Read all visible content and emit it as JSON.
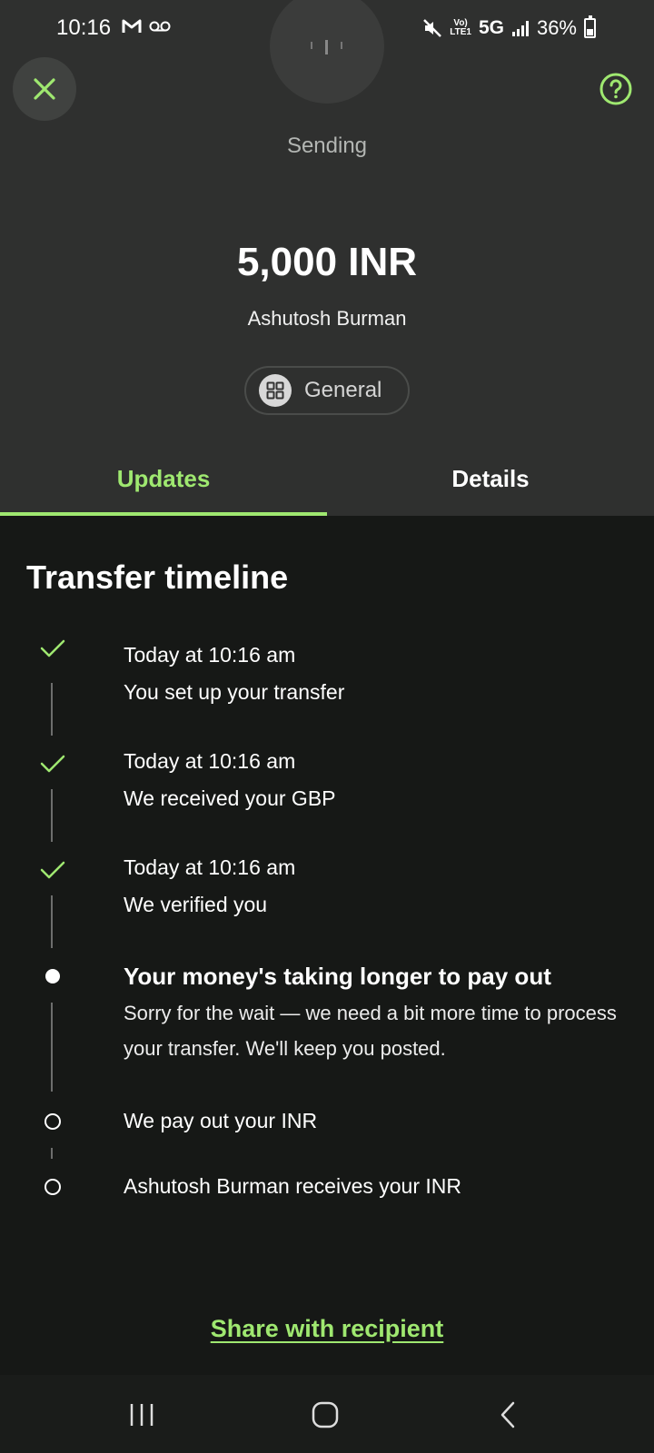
{
  "status_bar": {
    "time": "10:16",
    "network": "5G",
    "volte": "Vo)\nLTE1",
    "battery": "36%",
    "icons": [
      "gmail-icon",
      "voicemail-icon",
      "mute-icon",
      "signal-icon",
      "battery-icon"
    ]
  },
  "header": {
    "status": "Sending",
    "amount": "5,000 INR",
    "recipient": "Ashutosh Burman",
    "category": "General"
  },
  "tabs": [
    {
      "label": "Updates",
      "active": true
    },
    {
      "label": "Details",
      "active": false
    }
  ],
  "timeline": {
    "title": "Transfer timeline",
    "steps": [
      {
        "state": "done",
        "time": "Today at 10:16 am",
        "label": "You set up your transfer"
      },
      {
        "state": "done",
        "time": "Today at 10:16 am",
        "label": "We received your GBP"
      },
      {
        "state": "done",
        "time": "Today at 10:16 am",
        "label": "We verified you"
      },
      {
        "state": "current",
        "label": "Your money's taking longer to pay out",
        "description": "Sorry for the wait — we need a bit more time to process your transfer. We'll keep you posted."
      },
      {
        "state": "pending",
        "label": "We pay out your INR"
      },
      {
        "state": "pending",
        "label": "Ashutosh Burman receives your INR"
      }
    ]
  },
  "share": {
    "label": "Share with recipient"
  },
  "colors": {
    "accent": "#9fe870",
    "top_bg": "#2f302f",
    "body_bg": "#161816"
  }
}
